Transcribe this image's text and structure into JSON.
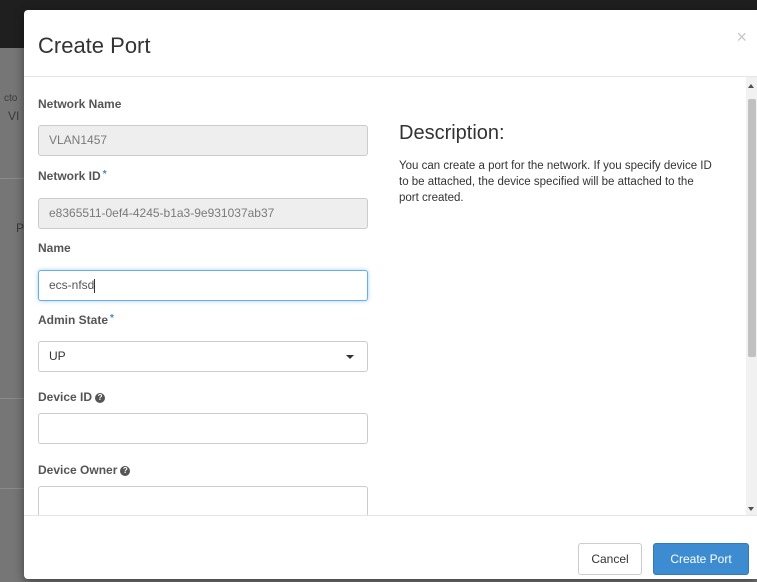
{
  "background": {
    "fragments": [
      "cto",
      "VI",
      "P"
    ]
  },
  "modal": {
    "title": "Create Port",
    "close_glyph": "×",
    "close_icon": "close-icon"
  },
  "form": {
    "network_name": {
      "label": "Network Name",
      "value": "VLAN1457",
      "readonly": true
    },
    "network_id": {
      "label": "Network ID",
      "required_mark": "*",
      "value": "e8365511-0ef4-4245-b1a3-9e931037ab37",
      "readonly": true
    },
    "name": {
      "label": "Name",
      "value": "ecs-nfsd"
    },
    "admin_state": {
      "label": "Admin State",
      "required_mark": "*",
      "selected": "UP"
    },
    "device_id": {
      "label": "Device ID",
      "help_icon": "question-circle-icon",
      "help_glyph": "?",
      "value": ""
    },
    "device_owner": {
      "label": "Device Owner",
      "help_icon": "question-circle-icon",
      "help_glyph": "?",
      "value": ""
    }
  },
  "description": {
    "title": "Description:",
    "text": "You can create a port for the network. If you specify device ID to be attached, the device specified will be attached to the port created."
  },
  "footer": {
    "cancel_label": "Cancel",
    "submit_label": "Create Port"
  },
  "colors": {
    "primary": "#3d8bd1",
    "required": "#3a87d4",
    "focus": "#66afe9"
  }
}
